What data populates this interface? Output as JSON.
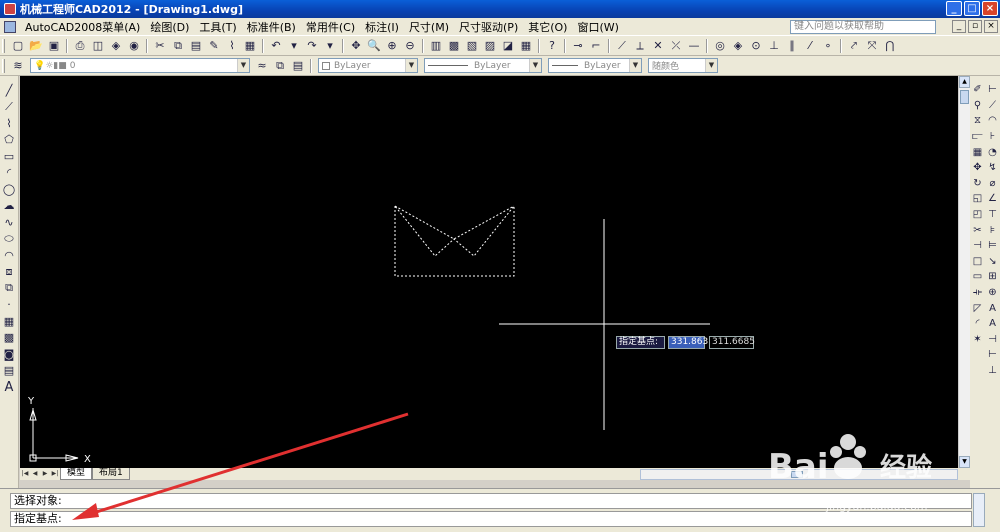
{
  "window": {
    "title": "机械工程师CAD2012 - [Drawing1.dwg]",
    "min": "_",
    "max": "□",
    "close": "×"
  },
  "menu": {
    "items": [
      "AutoCAD2008菜单(A)",
      "绘图(D)",
      "工具(T)",
      "标准件(B)",
      "常用件(C)",
      "标注(I)",
      "尺寸(M)",
      "尺寸驱动(P)",
      "其它(O)",
      "窗口(W)"
    ],
    "help_placeholder": "键入问题以获取帮助"
  },
  "layer_toolbar": {
    "layer_value": "0",
    "color": "ByLayer",
    "linetype": "ByLayer",
    "lineweight": "ByLayer",
    "plotstyle": "随颜色"
  },
  "dynamic_input": {
    "prompt": "指定基点:",
    "x": "331.863",
    "y": "311.6685"
  },
  "ucs": {
    "x_label": "X",
    "y_label": "Y"
  },
  "tabs": {
    "model": "模型",
    "layout1": "布局1"
  },
  "command": {
    "line1": "选择对象:",
    "line2": "指定基点:"
  },
  "watermark": {
    "brand": "Bai",
    "brand_cn": "经验",
    "url": "jingyan.baidu.com"
  },
  "colors": {
    "canvas": "#000000",
    "titlebar": "#0a4fc8",
    "arrow": "#e03030",
    "entity": "#ffffff"
  }
}
